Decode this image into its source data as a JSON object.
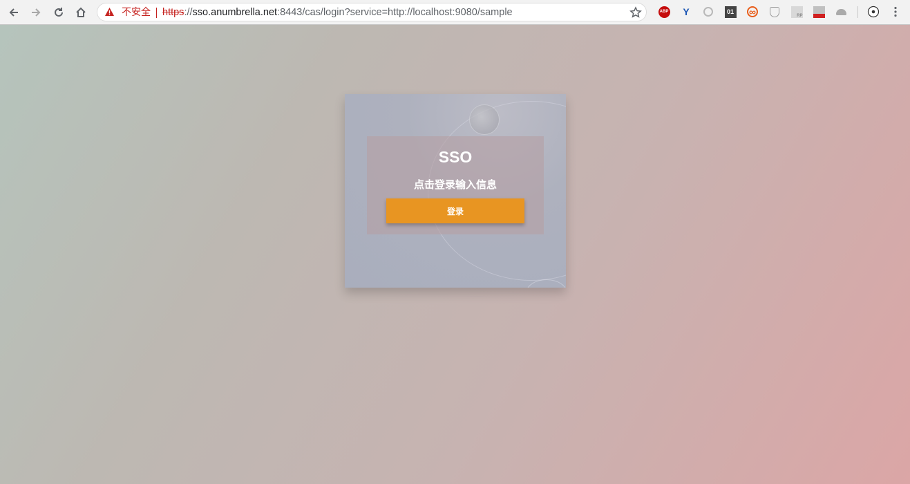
{
  "browser": {
    "insecure_label": "不安全",
    "url": {
      "scheme": "https",
      "sep": "://",
      "host": "sso.anumbrella.net",
      "rest": ":8443/cas/login?service=http://localhost:9080/sample"
    },
    "extensions": [
      {
        "name": "adblock-icon",
        "label": "ABP",
        "color": "#c50d0d"
      },
      {
        "name": "y-extension-icon",
        "label": "Y",
        "color": "#1b56b4"
      },
      {
        "name": "refresh-extension-icon",
        "label": "",
        "color": "#b8b8b8"
      },
      {
        "name": "binary-extension-icon",
        "label": "01",
        "color": "#444444"
      },
      {
        "name": "infinity-extension-icon",
        "label": "∞",
        "color": "#e85d1a"
      },
      {
        "name": "shield-extension-icon",
        "label": "",
        "color": "#999999"
      },
      {
        "name": "rp-extension-icon",
        "label": "RP",
        "color": "#888888"
      },
      {
        "name": "puzzle-extension-icon",
        "label": "",
        "color": "#d02020"
      },
      {
        "name": "umbrella-extension-icon",
        "label": "",
        "color": "#aaaaaa"
      }
    ]
  },
  "login": {
    "title": "SSO",
    "subtitle": "点击登录输入信息",
    "button_label": "登录"
  },
  "colors": {
    "accent": "#e89522",
    "warning": "#c5221f"
  }
}
